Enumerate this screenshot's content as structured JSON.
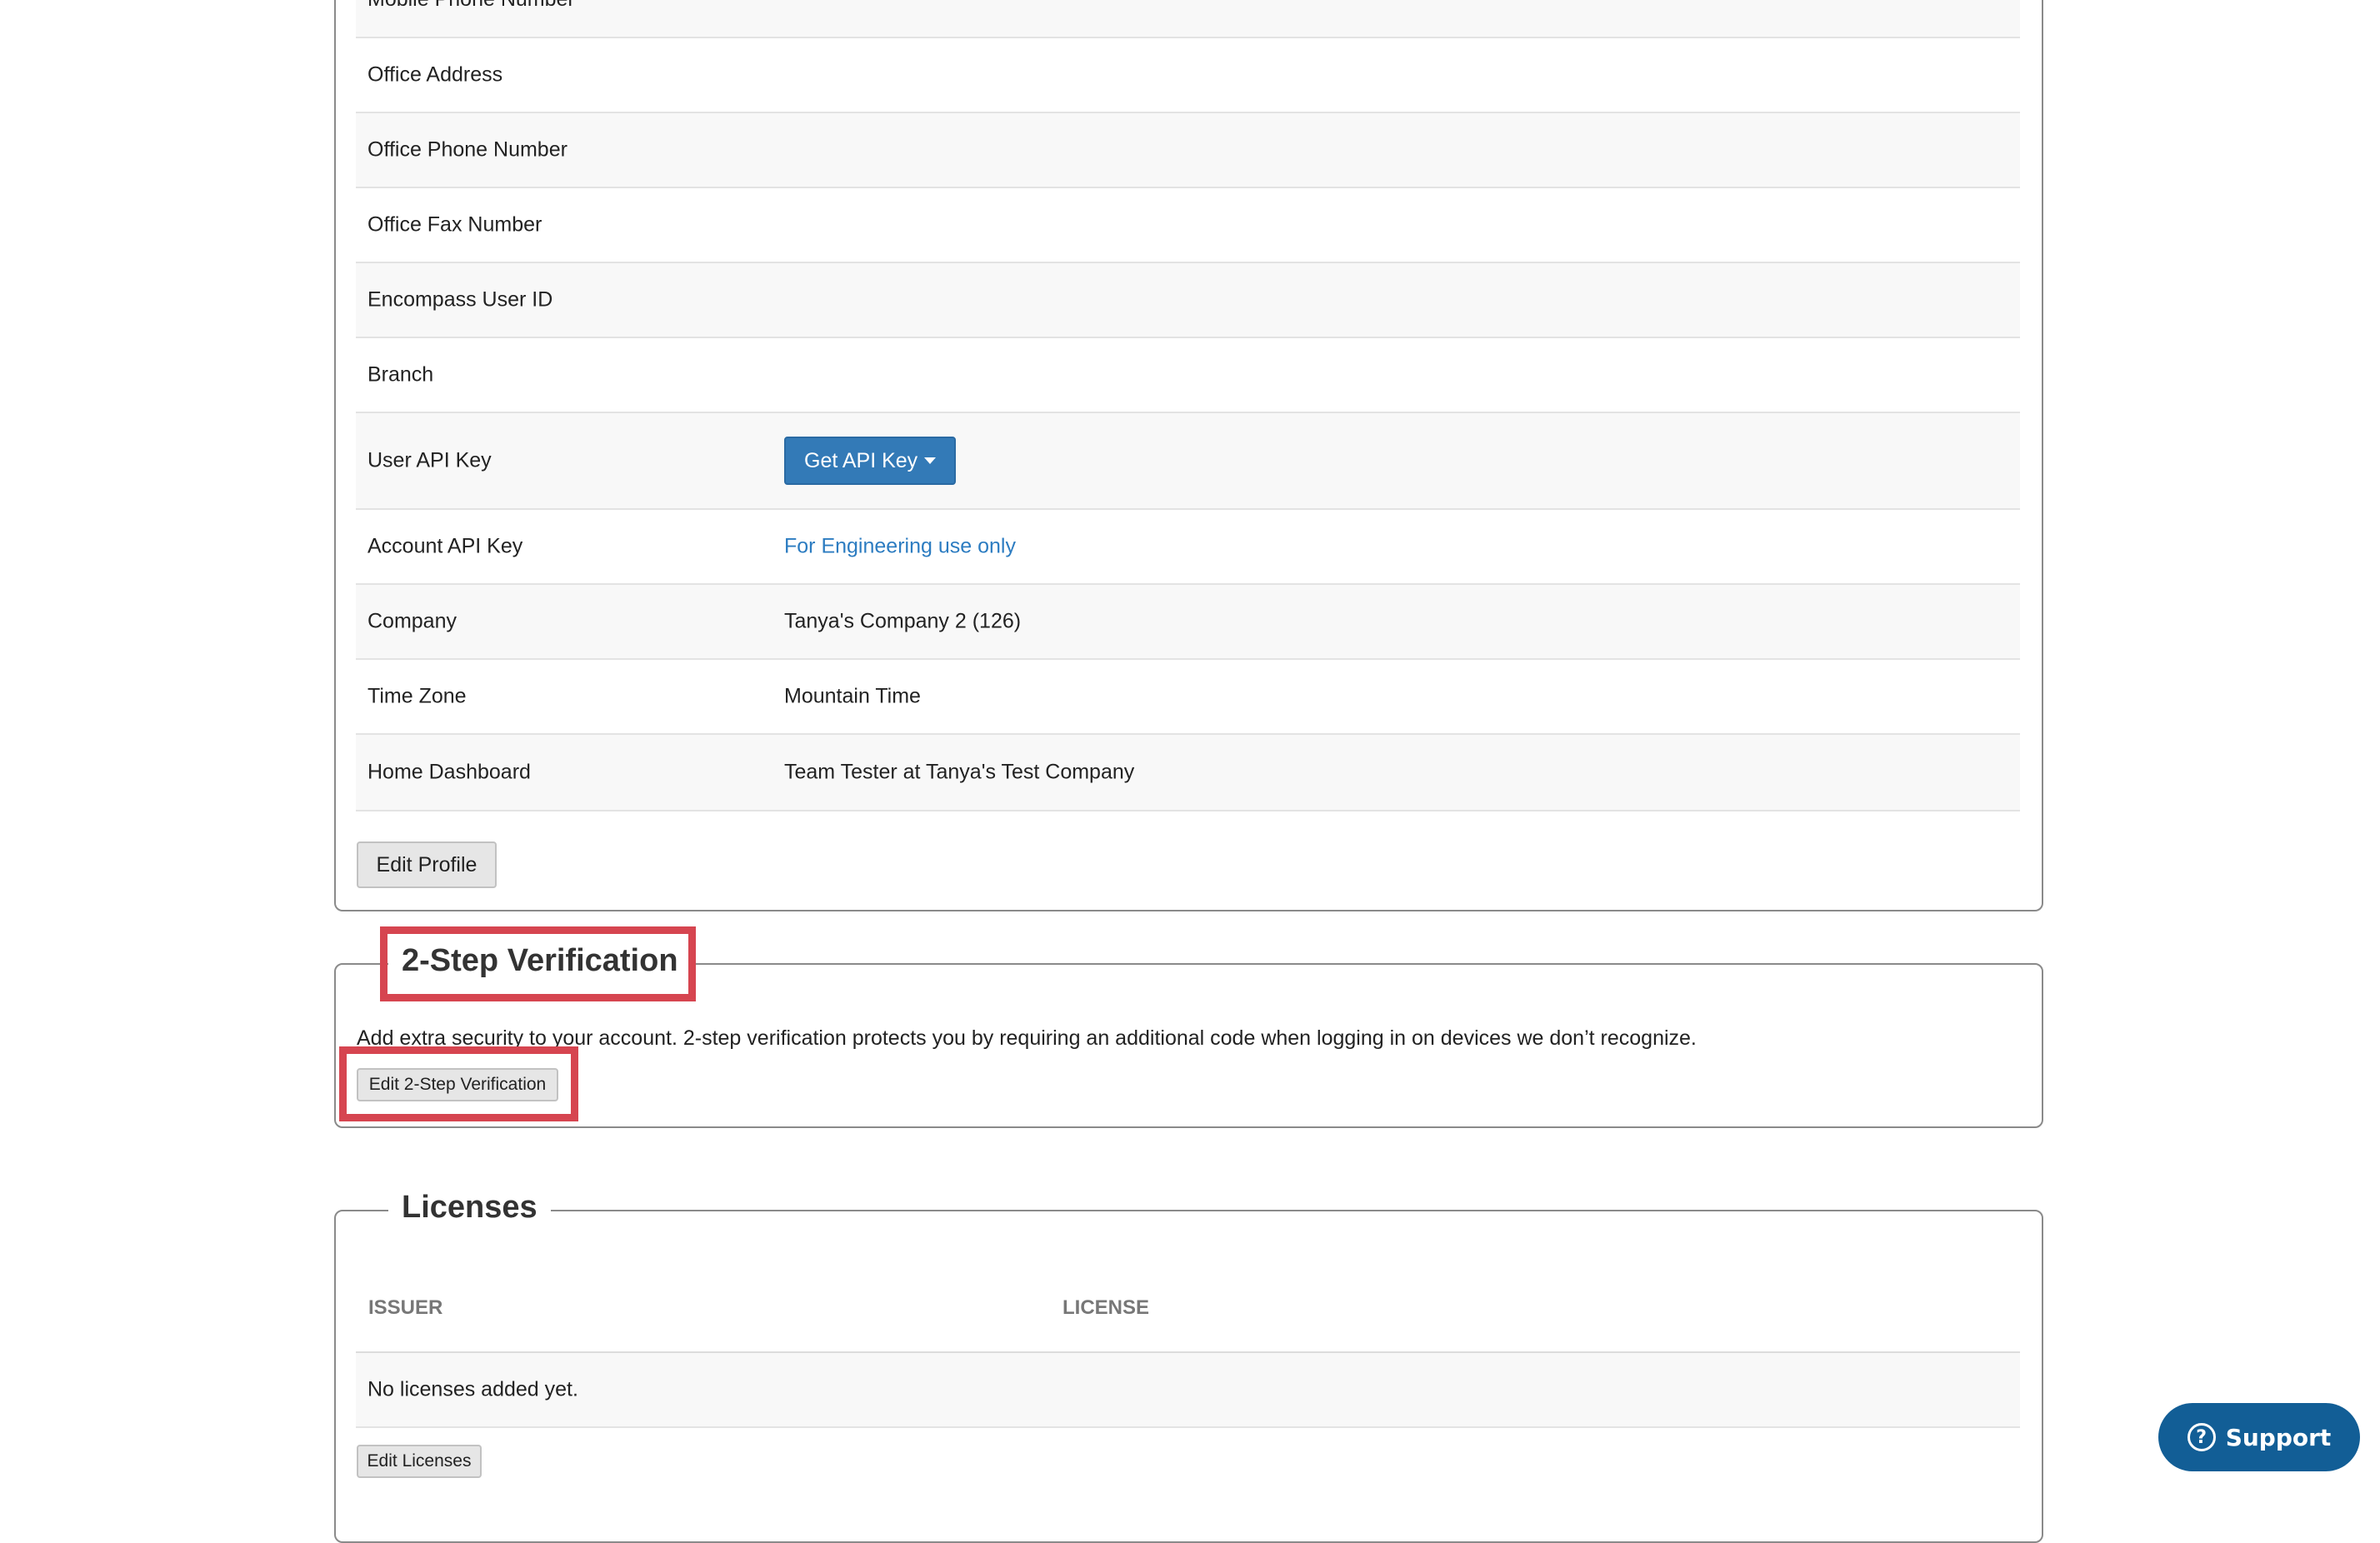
{
  "profile": {
    "rows": [
      {
        "label": "Mobile Phone Number",
        "value": ""
      },
      {
        "label": "Office Address",
        "value": ""
      },
      {
        "label": "Office Phone Number",
        "value": ""
      },
      {
        "label": "Office Fax Number",
        "value": ""
      },
      {
        "label": "Encompass User ID",
        "value": ""
      },
      {
        "label": "Branch",
        "value": ""
      },
      {
        "label": "User API Key",
        "button": "Get API Key"
      },
      {
        "label": "Account API Key",
        "value": "For Engineering use only"
      },
      {
        "label": "Company",
        "value": "Tanya's Company 2 (126)"
      },
      {
        "label": "Time Zone",
        "value": "Mountain Time"
      },
      {
        "label": "Home Dashboard",
        "value": "Team Tester at Tanya's Test Company"
      }
    ],
    "edit_button": "Edit Profile"
  },
  "two_step": {
    "title": "2-Step Verification",
    "description": "Add extra security to your account. 2-step verification protects you by requiring an additional code when logging in on devices we don’t recognize.",
    "edit_button": "Edit 2-Step Verification"
  },
  "licenses": {
    "title": "Licenses",
    "columns": [
      "ISSUER",
      "LICENSE"
    ],
    "empty_message": "No licenses added yet.",
    "edit_button": "Edit Licenses"
  },
  "support": {
    "label": "Support",
    "icon": "question-circle-icon",
    "icon_glyph": "?"
  },
  "colors": {
    "primary_button": "#337ab7",
    "link": "#2c7cc1",
    "highlight": "#d64550",
    "support": "#125e96"
  }
}
